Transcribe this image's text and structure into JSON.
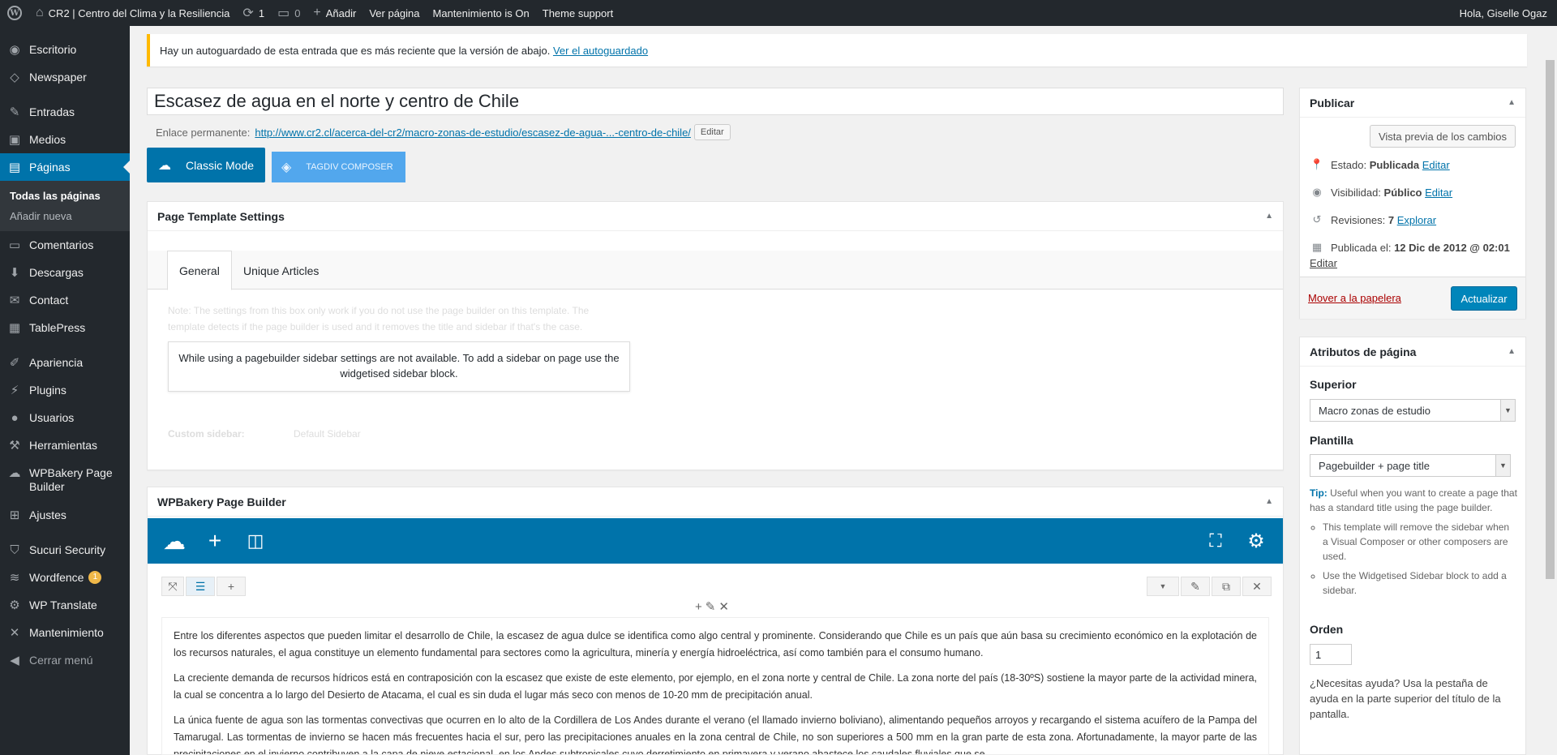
{
  "adminbar": {
    "site_name": "CR2 | Centro del Clima y la Resiliencia",
    "updates_count": "1",
    "comments_count": "0",
    "new_label": "Añadir",
    "view_page": "Ver página",
    "maintenance": "Mantenimiento is On",
    "theme_support": "Theme support",
    "greeting": "Hola, Giselle Ogaz"
  },
  "sidebar": {
    "items": [
      {
        "label": "Escritorio",
        "icon": "dashboard-icon"
      },
      {
        "label": "Newspaper",
        "icon": "newspaper-icon"
      },
      {
        "label": "Entradas",
        "icon": "pin-icon"
      },
      {
        "label": "Medios",
        "icon": "media-icon"
      },
      {
        "label": "Páginas",
        "icon": "pages-icon"
      },
      {
        "label": "Comentarios",
        "icon": "comments-icon"
      },
      {
        "label": "Descargas",
        "icon": "download-icon"
      },
      {
        "label": "Contact",
        "icon": "mail-icon"
      },
      {
        "label": "TablePress",
        "icon": "table-icon"
      },
      {
        "label": "Apariencia",
        "icon": "brush-icon"
      },
      {
        "label": "Plugins",
        "icon": "plugin-icon"
      },
      {
        "label": "Usuarios",
        "icon": "user-icon"
      },
      {
        "label": "Herramientas",
        "icon": "wrench-icon"
      },
      {
        "label": "WPBakery Page Builder",
        "icon": "cloud-icon"
      },
      {
        "label": "Ajustes",
        "icon": "settings-icon"
      },
      {
        "label": "Sucuri Security",
        "icon": "shield-icon"
      },
      {
        "label": "Wordfence",
        "icon": "wordfence-icon",
        "badge": "1"
      },
      {
        "label": "WP Translate",
        "icon": "gear-icon"
      },
      {
        "label": "Mantenimiento",
        "icon": "tools-icon"
      },
      {
        "label": "Cerrar menú",
        "icon": "collapse-icon"
      }
    ],
    "submenu": [
      "Todas las páginas",
      "Añadir nueva"
    ]
  },
  "notice": {
    "text": "Hay un autoguardado de esta entrada que es más reciente que la versión de abajo.",
    "link": "Ver el autoguardado"
  },
  "editor": {
    "title": "Escasez de agua en el norte y centro de Chile",
    "permalink_label": "Enlace permanente:",
    "permalink_base": "http://www.cr2.cl/acerca-del-cr2/macro-zonas-de-estudio/",
    "permalink_slug": "escasez-de-agua-...-centro-de-chile/",
    "edit_btn": "Editar",
    "classic_mode": "Classic Mode",
    "tagdiv": "TAGDIV COMPOSER"
  },
  "template_settings": {
    "title": "Page Template Settings",
    "tabs": [
      "General",
      "Unique Articles"
    ],
    "faded_note": "Note: The settings from this box only work if you do not use the page builder on this template. The template detects if the page builder is used and it removes the title and sidebar if that's the case.",
    "pagebuilder_notice": "While using a pagebuilder sidebar settings are not available. To add a sidebar on page use the widgetised sidebar block.",
    "custom_sidebar_label": "Custom sidebar:",
    "custom_sidebar_value": "Default Sidebar"
  },
  "wpbakery": {
    "title": "WPBakery Page Builder",
    "paragraphs": [
      "Entre los diferentes aspectos que pueden limitar el desarrollo de Chile, la escasez de agua dulce se identifica como algo central y prominente. Considerando que Chile es un país que aún basa su crecimiento económico en la explotación de los recursos naturales, el agua constituye un elemento fundamental para sectores como la agricultura, minería y energía hidroeléctrica, así como también para el consumo humano.",
      "La creciente demanda de recursos hídricos está en contraposición con la escasez que existe de este elemento, por ejemplo, en el zona norte y central de Chile. La zona norte del país (18-30ºS) sostiene la mayor parte de la actividad minera, la cual se concentra a lo largo del Desierto de Atacama, el cual es sin duda el lugar más seco con menos de 10-20 mm de precipitación anual.",
      "La única fuente de agua son las  tormentas convectivas que ocurren en lo alto de la Cordillera de Los Andes durante el verano (el llamado invierno boliviano), alimentando pequeños arroyos y recargando el sistema acuífero de la Pampa del Tamarugal. Las tormentas de invierno se hacen más frecuentes hacia el sur, pero las precipitaciones anuales en la zona central de Chile, no son superiores a 500 mm en la gran parte de esta zona. Afortunadamente, la mayor parte de las precipitaciones en el invierno contribuyen a la capa de nieve estacional, en los Andes subtropicales cuyo derretimiento en primavera y verano abastece los caudales fluviales que se"
    ]
  },
  "publish": {
    "title": "Publicar",
    "preview_btn": "Vista previa de los cambios",
    "status_label": "Estado:",
    "status_value": "Publicada",
    "visibility_label": "Visibilidad:",
    "visibility_value": "Público",
    "revisions_label": "Revisiones:",
    "revisions_value": "7",
    "explore": "Explorar",
    "published_label": "Publicada el:",
    "published_value": "12 Dic de 2012 @ 02:01",
    "edit": "Editar",
    "trash": "Mover a la papelera",
    "update": "Actualizar"
  },
  "attributes": {
    "title": "Atributos de página",
    "parent_label": "Superior",
    "parent_value": "Macro zonas de estudio",
    "template_label": "Plantilla",
    "template_value": "Pagebuilder + page title",
    "tip_label": "Tip:",
    "tip_text": "Useful when you want to create a page that has a standard title using the page builder.",
    "tip_items": [
      "This template will remove the sidebar when a Visual Composer or other composers are used.",
      "Use the Widgetised Sidebar block to add a sidebar."
    ],
    "order_label": "Orden",
    "order_value": "1",
    "help_text": "¿Necesitas ayuda? Usa la pestaña de ayuda en la parte superior del título de la pantalla."
  }
}
